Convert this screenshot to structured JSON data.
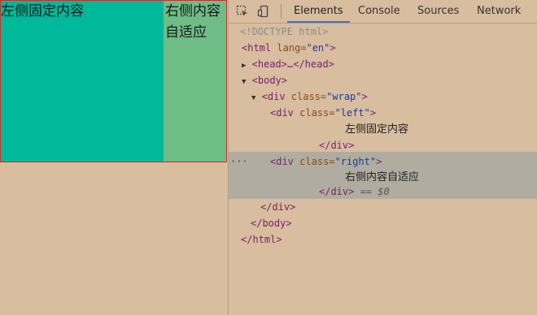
{
  "page": {
    "left_text": "左侧固定内容",
    "right_text": "右侧内容自适应"
  },
  "devtools": {
    "tabs": [
      "Elements",
      "Console",
      "Sources",
      "Network"
    ],
    "active_tab": "Elements",
    "tree": {
      "doctype": "<!DOCTYPE html>",
      "html_open": "<html",
      "html_attr": " lang=",
      "html_val": "\"en\"",
      "html_close_bracket": ">",
      "head": "<head>…</head>",
      "body_open": "<body>",
      "wrap_open_tag": "<div",
      "wrap_attr": " class=",
      "wrap_val": "\"wrap\"",
      "left_open_tag": "<div",
      "left_attr": " class=",
      "left_val": "\"left\"",
      "left_text": "左侧固定内容",
      "div_close": "</div>",
      "right_open_tag": "<div",
      "right_attr": " class=",
      "right_val": "\"right\"",
      "right_text": "右侧内容自适应",
      "selected_marker": "== $0",
      "gt": ">",
      "body_close": "</body>",
      "html_close": "</html>",
      "ellipsis": "···"
    }
  }
}
